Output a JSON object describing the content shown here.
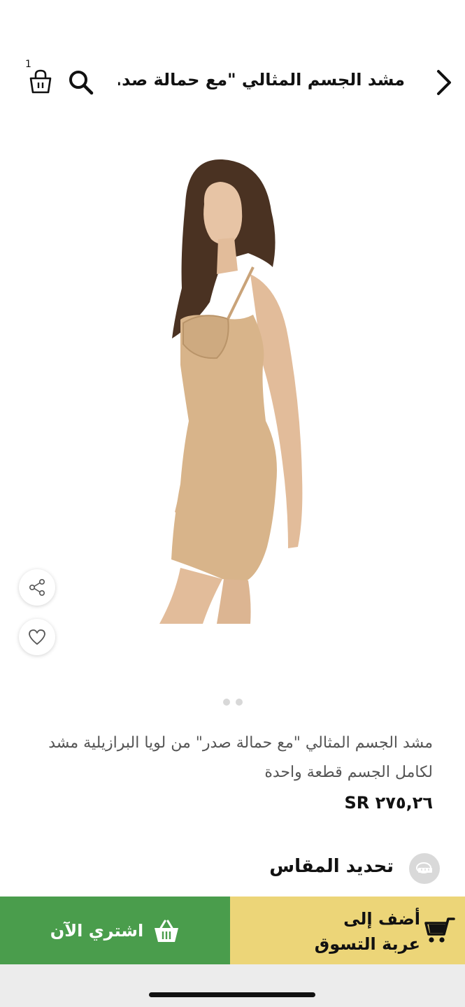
{
  "header": {
    "title": "مشد الجسم المثالي \"مع حمالة صد...",
    "cart_count": "1",
    "icons": {
      "back": "chevron-right-icon",
      "search": "search-icon",
      "cart": "shopping-bag-icon"
    }
  },
  "gallery": {
    "page_count": 2,
    "active_index": 0
  },
  "product": {
    "name": "مشد الجسم المثالي \"مع حمالة صدر\" من لويا البرازيلية مشد لكامل الجسم قطعة واحدة",
    "price": "SR ٢٧٥,٢٦"
  },
  "size": {
    "label": "تحديد المقاس",
    "icon": "tape-measure-icon"
  },
  "actions": {
    "add_to_cart_label": "أضف إلى\nعربة التسوق",
    "buy_now_label": "اشتري الآن"
  },
  "colors": {
    "buy_now_bg": "#4a9d4c",
    "add_to_cart_bg": "#ecd578",
    "product_skin_tone": "#d8b48a"
  }
}
